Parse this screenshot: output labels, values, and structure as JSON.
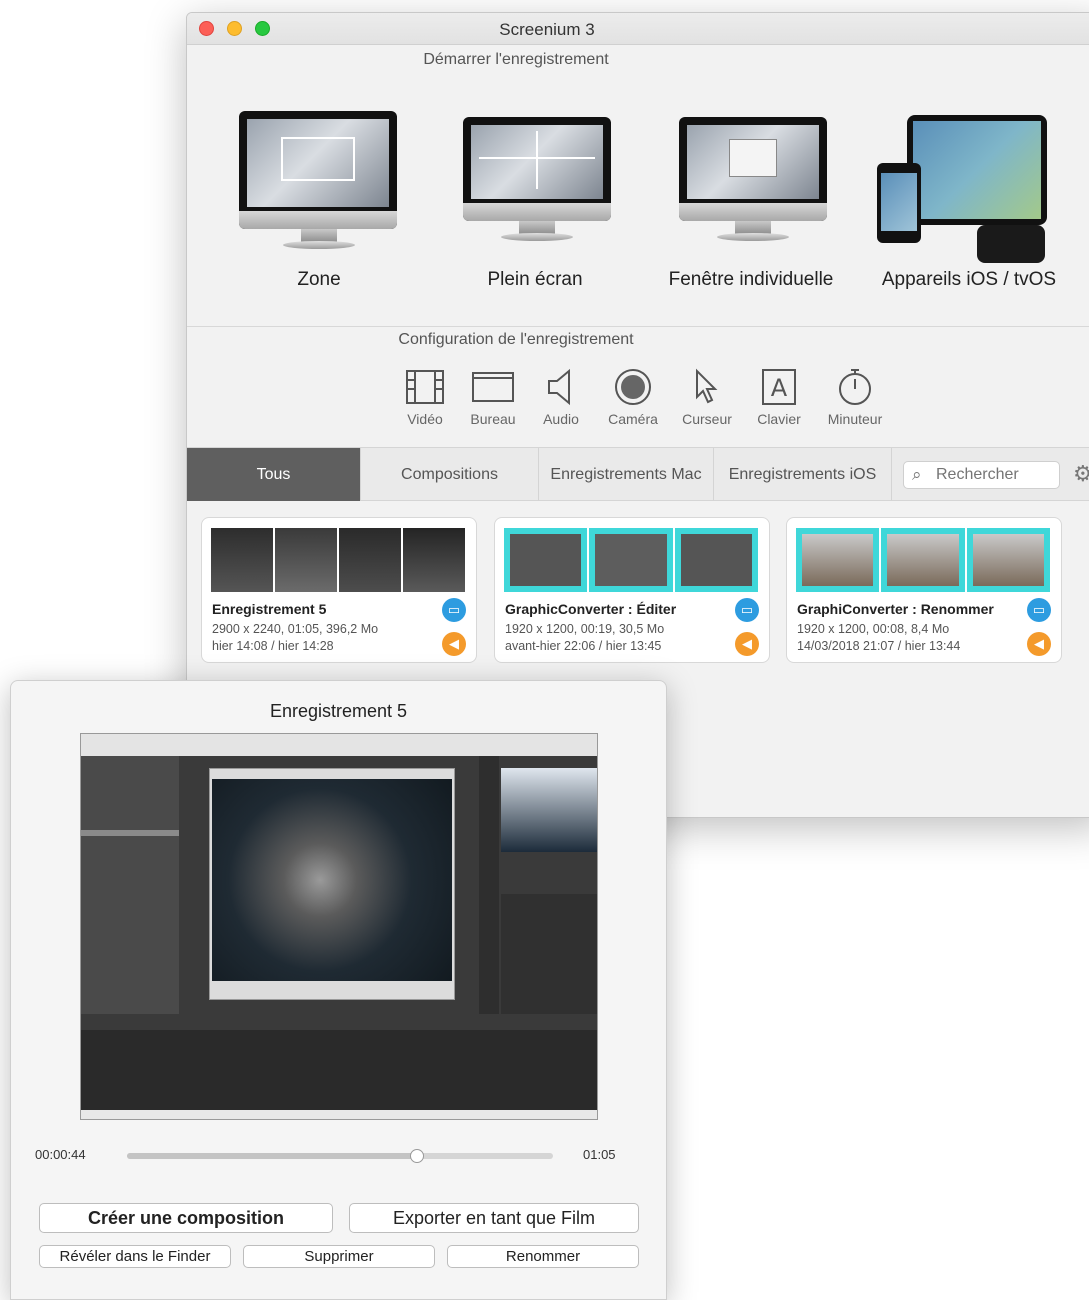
{
  "window": {
    "title": "Screenium 3",
    "record_section_title": "Démarrer l'enregistrement",
    "config_section_title": "Configuration de l'enregistrement"
  },
  "modes": [
    {
      "label": "Zone",
      "icon": "monitor-zone-icon"
    },
    {
      "label": "Plein écran",
      "icon": "monitor-fullscreen-icon"
    },
    {
      "label": "Fenêtre individuelle",
      "icon": "monitor-window-icon"
    },
    {
      "label": "Appareils iOS / tvOS",
      "icon": "ios-devices-icon"
    }
  ],
  "config": [
    {
      "label": "Vidéo",
      "icon": "film-icon",
      "glyph": "🎞"
    },
    {
      "label": "Bureau",
      "icon": "desktop-icon",
      "glyph": "▭"
    },
    {
      "label": "Audio",
      "icon": "speaker-icon",
      "glyph": "◁"
    },
    {
      "label": "Caméra",
      "icon": "camera-icon",
      "glyph": "◉"
    },
    {
      "label": "Curseur",
      "icon": "cursor-icon",
      "glyph": "⇖"
    },
    {
      "label": "Clavier",
      "icon": "keyboard-icon",
      "glyph": "A"
    },
    {
      "label": "Minuteur",
      "icon": "timer-icon",
      "glyph": "⏱"
    }
  ],
  "tabs": [
    {
      "label": "Tous",
      "active": true
    },
    {
      "label": "Compositions",
      "active": false
    },
    {
      "label": "Enregistrements Mac",
      "active": false
    },
    {
      "label": "Enregistrements iOS",
      "active": false
    }
  ],
  "search": {
    "placeholder": "Rechercher"
  },
  "recordings": [
    {
      "title": "Enregistrement 5",
      "meta1": "2900 x 2240, 01:05, 396,2 Mo",
      "meta2": "hier 14:08 / hier 14:28"
    },
    {
      "title": "GraphicConverter : Éditer",
      "meta1": "1920 x 1200, 00:19, 30,5 Mo",
      "meta2": "avant-hier 22:06 / hier 13:45"
    },
    {
      "title": "GraphiConverter : Renommer",
      "meta1": "1920 x 1200, 00:08, 8,4 Mo",
      "meta2": "14/03/2018 21:07 / hier 13:44"
    }
  ],
  "popover": {
    "title": "Enregistrement 5",
    "time_current": "00:00:44",
    "time_total": "01:05",
    "progress": 0.68,
    "buttons": {
      "create": "Créer une composition",
      "export": "Exporter en tant que Film",
      "reveal": "Révéler dans le Finder",
      "delete": "Supprimer",
      "rename": "Renommer"
    }
  },
  "colors": {
    "accent_blue": "#2d9ce0",
    "accent_orange": "#f49a2b",
    "active_tab": "#5f5f5f",
    "thumb_teal": "#3fd7d9"
  }
}
